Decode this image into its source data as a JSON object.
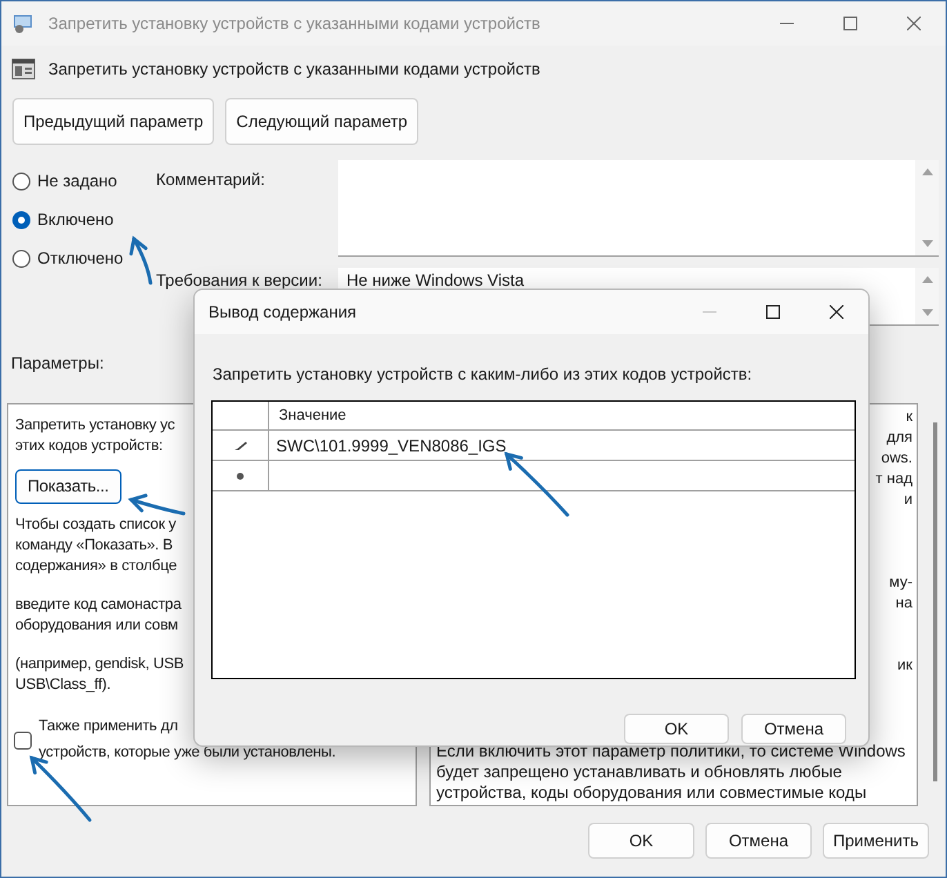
{
  "window": {
    "title": "Запретить установку устройств с указанными кодами устройств"
  },
  "policy_name": "Запретить установку устройств с указанными кодами устройств",
  "nav_buttons": [
    "Предыдущий параметр",
    "Следующий параметр"
  ],
  "states": [
    {
      "label": "Не задано",
      "selected": false
    },
    {
      "label": "Включено",
      "selected": true
    },
    {
      "label": "Отключено",
      "selected": false
    }
  ],
  "comment": {
    "label": "Комментарий:"
  },
  "supported_on": {
    "label": "Требования к версии:",
    "value": "Не ниже Windows Vista"
  },
  "options": {
    "label": "Параметры:",
    "intro": [
      "Запретить установку ус",
      "этих кодов устройств:"
    ],
    "show_button": "Показать...",
    "paragraphs": [
      [
        "Чтобы создать список у",
        "команду «Показать». В",
        "содержания» в столбце"
      ],
      [
        "введите код самонастра",
        "оборудования или совм"
      ],
      [
        "(например, gendisk, USB",
        "USB\\Class_ff)."
      ]
    ],
    "checkbox": {
      "lines": [
        "Также применить дл",
        "устройств, которые уже были установлены."
      ],
      "checked": false
    }
  },
  "help": [
    {
      "kind": "fragment",
      "text": "к"
    },
    {
      "kind": "fragment",
      "text": "для"
    },
    {
      "kind": "fragment",
      "text": "ows."
    },
    {
      "kind": "fragment",
      "text": "т над"
    },
    {
      "kind": "fragment",
      "text": "и"
    },
    {
      "kind": "fragment",
      "text": "му-"
    },
    {
      "kind": "fragment",
      "text": "на"
    },
    {
      "kind": "fragment",
      "text": "ик"
    },
    {
      "kind": "line",
      "text": "Если включить этот параметр политики, то системе Windows"
    },
    {
      "kind": "line",
      "text": "будет запрещено устанавливать и обновлять любые"
    },
    {
      "kind": "line",
      "text": "устройства, коды оборудования или совместимые коды"
    }
  ],
  "buttons": [
    "OK",
    "Отмена",
    "Применить"
  ],
  "dialog": {
    "title": "Вывод содержания",
    "prompt": "Запретить установку устройств с каким-либо из этих кодов устройств:",
    "table": {
      "columns": [
        "Значение"
      ],
      "rows": [
        {
          "kind": "edit",
          "value": "SWC\\101.9999_VEN8086_IGS"
        },
        {
          "kind": "new"
        }
      ]
    },
    "buttons": [
      "OK",
      "Отмена"
    ]
  }
}
